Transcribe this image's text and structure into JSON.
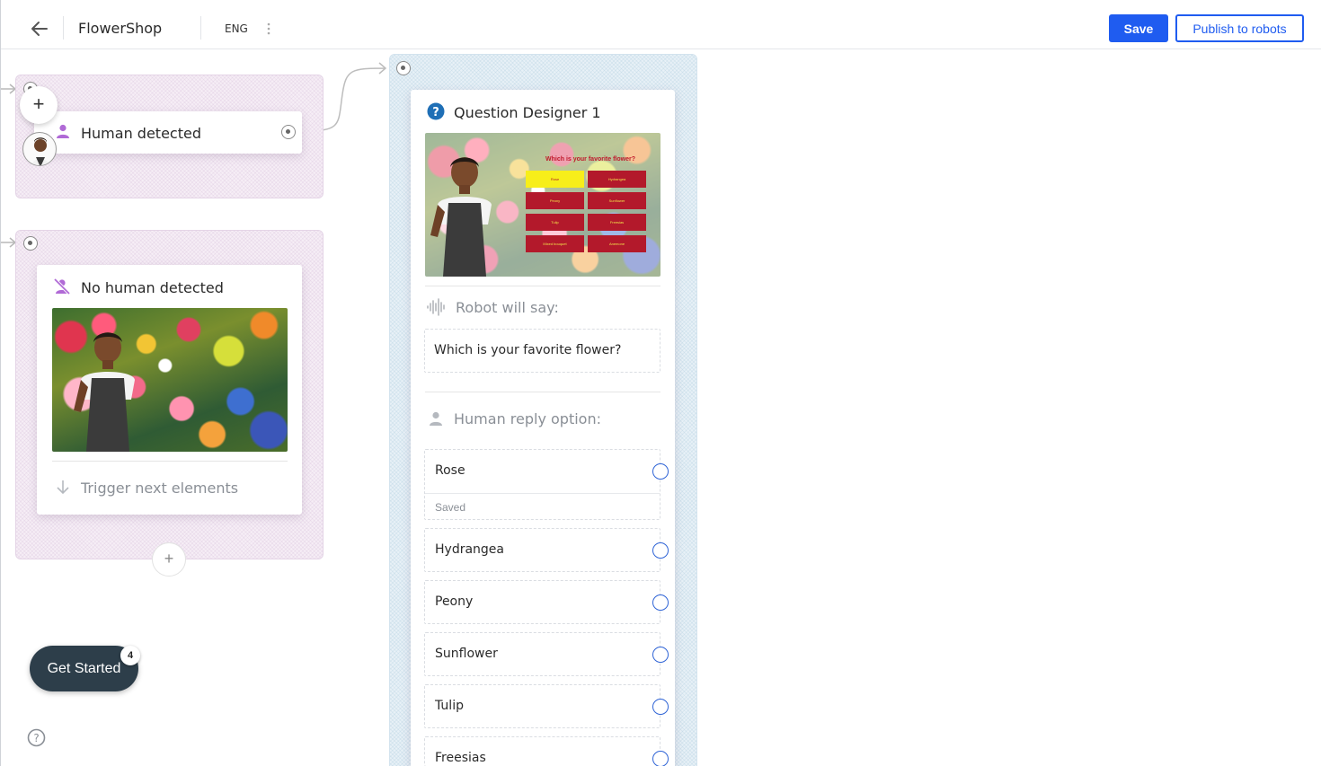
{
  "header": {
    "app_title": "FlowerShop",
    "language": "ENG",
    "save_label": "Save",
    "publish_label": "Publish to robots",
    "accent_color": "#1f5cf0"
  },
  "nodes": {
    "human_detected": {
      "title": "Human detected",
      "icon": "person-icon",
      "add_button": "+"
    },
    "no_human_detected": {
      "title": "No human detected",
      "icon": "person-off-icon",
      "trigger_label": "Trigger next elements",
      "add_button": "+"
    },
    "question_designer": {
      "title": "Question Designer 1",
      "icon": "question-icon",
      "preview_question": "Which is your favorite flower?",
      "preview_options": [
        "Rose",
        "Hydrangea",
        "Peony",
        "Sunflower",
        "Tulip",
        "Freesias",
        "Mixed bouquet",
        "Anemone"
      ],
      "robot_say_label": "Robot will say:",
      "robot_say_text": "Which is your favorite flower?",
      "human_reply_label": "Human reply option:",
      "reply_options": [
        {
          "label": "Rose",
          "status": "Saved"
        },
        {
          "label": "Hydrangea"
        },
        {
          "label": "Peony"
        },
        {
          "label": "Sunflower"
        },
        {
          "label": "Tulip"
        },
        {
          "label": "Freesias"
        }
      ]
    }
  },
  "footer": {
    "get_started_label": "Get Started",
    "get_started_count": "4",
    "help_icon": "help-circle-icon"
  }
}
